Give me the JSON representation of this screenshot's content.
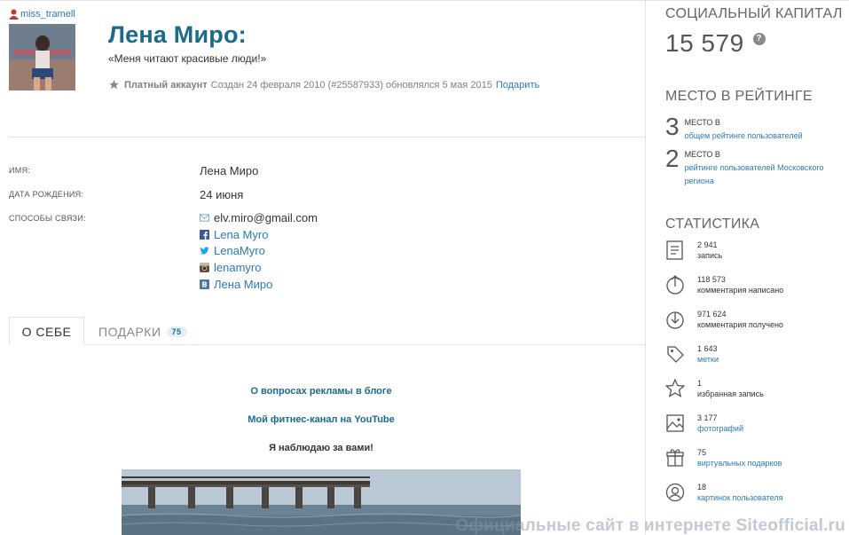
{
  "user": {
    "username": "miss_tramell",
    "name": "Лена Миро:",
    "quote": "«Меня читают красивые люди!»",
    "paid_label": "Платный аккаунт",
    "created_text": "Создан 24 февраля 2010 (#25587933) обновлялся 5 мая 2015",
    "gift_link": "Подарить"
  },
  "fields": {
    "name_label": "ИМЯ:",
    "name_value": "Лена Миро",
    "birth_label": "ДАТА РОЖДЕНИЯ:",
    "birth_value": "24 июня",
    "contacts_label": "СПОСОБЫ СВЯЗИ:",
    "email": "elv.miro@gmail.com",
    "facebook": "Lena Myro",
    "twitter": "LenaMyro",
    "instagram": "lenamyro",
    "vk": "Лена Миро"
  },
  "tabs": {
    "about": "О СЕБЕ",
    "gifts": "ПОДАРКИ",
    "gifts_count": "75"
  },
  "content": {
    "link1": "О вопросах рекламы в блоге",
    "link2": "Мой фитнес-канал на YouTube",
    "text1": "Я наблюдаю за вами!"
  },
  "sidebar": {
    "capital_title": "СОЦИАЛЬНЫЙ КАПИТАЛ",
    "capital_value": "15 579",
    "help_mark": "?",
    "rating_title": "МЕСТО В РЕЙТИНГЕ",
    "rank1_num": "3",
    "rank1_line1": "МЕСТО В",
    "rank1_link": "общем рейтинге пользователей",
    "rank2_num": "2",
    "rank2_line1": "МЕСТО В",
    "rank2_link": "рейтинге пользователей Московского региона",
    "stats_title": "СТАТИСТИКА",
    "stats": [
      {
        "num": "2 941",
        "label": "запись",
        "icon": "journal-icon",
        "link": false
      },
      {
        "num": "118 573",
        "label": "комментария написано",
        "icon": "comment-out-icon",
        "link": false
      },
      {
        "num": "971 624",
        "label": "комментария получено",
        "icon": "comment-in-icon",
        "link": false
      },
      {
        "num": "1 643",
        "label": "метки",
        "icon": "tag-icon",
        "link": true
      },
      {
        "num": "1",
        "label": "избранная запись",
        "icon": "star-icon",
        "link": false
      },
      {
        "num": "3 177",
        "label": "фотографий",
        "icon": "photo-icon",
        "link": true
      },
      {
        "num": "75",
        "label": "виртуальных подарков",
        "icon": "gift-icon",
        "link": true
      },
      {
        "num": "18",
        "label": "картинок пользователя",
        "icon": "userpic-icon",
        "link": true
      }
    ]
  },
  "watermark": "Официальные сайт в интернете Siteofficial.ru",
  "colors": {
    "accent": "#1a6a8c",
    "link": "#2a7bb5",
    "text": "#333333",
    "muted": "#7f7f7f"
  }
}
